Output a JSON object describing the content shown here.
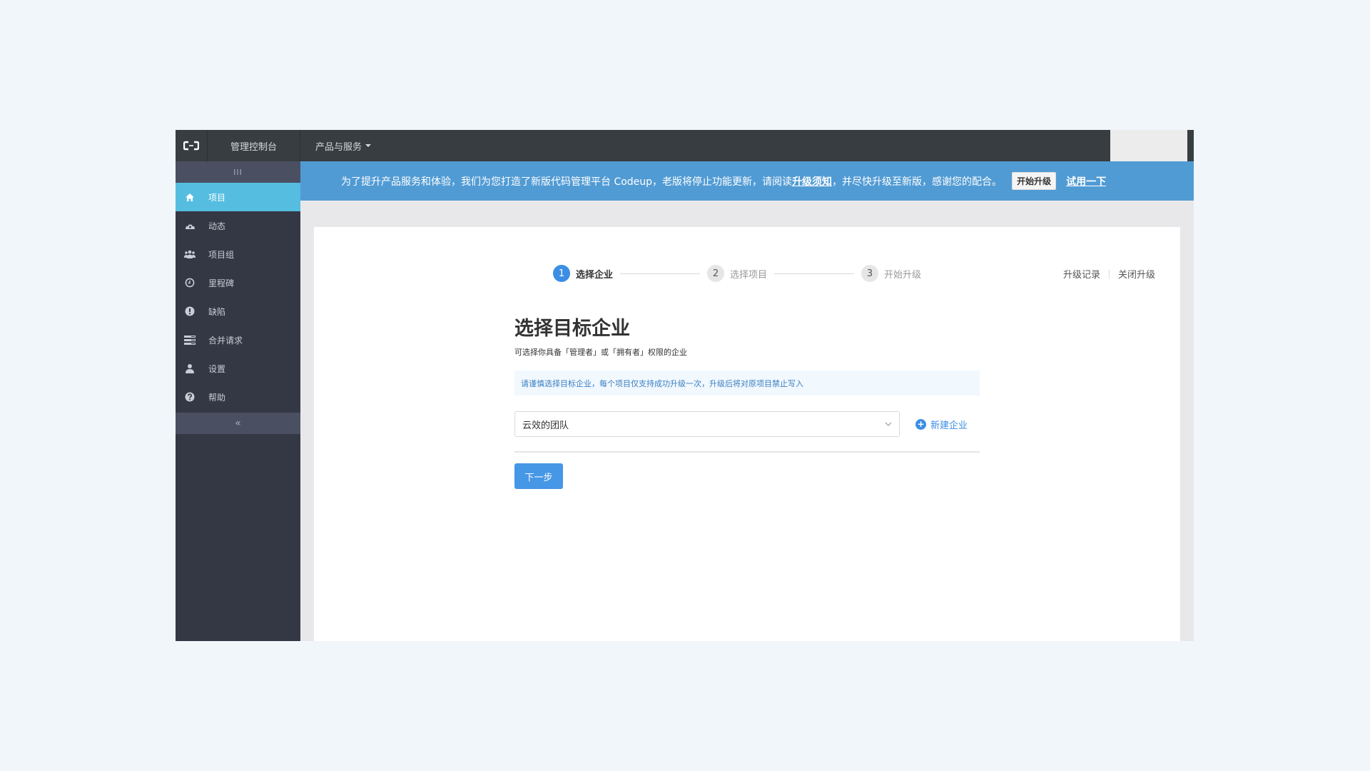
{
  "topbar": {
    "logo_icon": "aliyun-logo-icon",
    "console_label": "管理控制台",
    "products_label": "产品与服务"
  },
  "sidebar": {
    "toggle_label": "III",
    "items": [
      {
        "label": "项目",
        "icon": "home-icon",
        "active": true
      },
      {
        "label": "动态",
        "icon": "dashboard-icon",
        "active": false
      },
      {
        "label": "项目组",
        "icon": "users-icon",
        "active": false
      },
      {
        "label": "里程碑",
        "icon": "clock-icon",
        "active": false
      },
      {
        "label": "缺陷",
        "icon": "exclamation-icon",
        "active": false
      },
      {
        "label": "合并请求",
        "icon": "list-icon",
        "active": false
      },
      {
        "label": "设置",
        "icon": "user-icon",
        "active": false
      },
      {
        "label": "帮助",
        "icon": "question-icon",
        "active": false
      }
    ],
    "collapse_label": "«"
  },
  "banner": {
    "text_before": "为了提升产品服务和体验，我们为您打造了新版代码管理平台 Codeup，老版将停止功能更新，请阅读 ",
    "link_notice": "升级须知",
    "text_after": "，并尽快升级至新版，感谢您的配合。",
    "start_button": "开始升级",
    "try_link": "试用一下"
  },
  "steps": [
    {
      "num": "1",
      "label": "选择企业",
      "active": true
    },
    {
      "num": "2",
      "label": "选择项目",
      "active": false
    },
    {
      "num": "3",
      "label": "开始升级",
      "active": false
    }
  ],
  "card_links": {
    "history": "升级记录",
    "close": "关闭升级"
  },
  "content": {
    "title": "选择目标企业",
    "subtitle": "可选择你具备「管理者」或「拥有者」权限的企业",
    "notice": "请谨慎选择目标企业，每个项目仅支持成功升级一次，升级后将对原项目禁止写入",
    "select_value": "云效的团队",
    "new_enterprise": "新建企业",
    "next_button": "下一步"
  },
  "colors": {
    "topbar": "#373d41",
    "sidebar": "#343744",
    "sidebar_active": "#55bde0",
    "banner": "#519bd4",
    "primary": "#3b8ee3"
  }
}
